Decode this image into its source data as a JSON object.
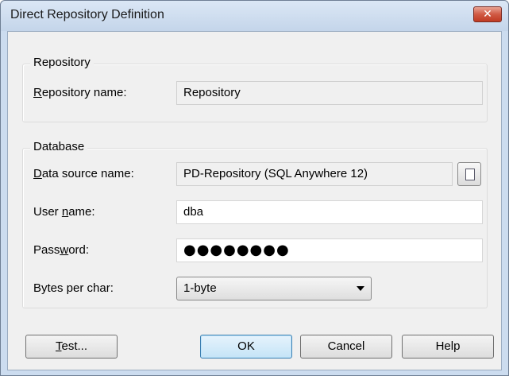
{
  "window": {
    "title": "Direct Repository Definition",
    "close_label": "✕"
  },
  "repository_group": {
    "title": "Repository",
    "name_label_underline": "R",
    "name_label_rest": "epository name:",
    "name_value": "Repository"
  },
  "database_group": {
    "title": "Database",
    "dsn_label_underline": "D",
    "dsn_label_rest": "ata source name:",
    "dsn_value": "PD-Repository (SQL Anywhere 12)",
    "user_label_pre": "User ",
    "user_label_underline": "n",
    "user_label_post": "ame:",
    "user_value": "dba",
    "password_label_pre": "Pass",
    "password_label_underline": "w",
    "password_label_post": "ord:",
    "password_value": "●●●●●●●●",
    "bytes_label": "Bytes per char:",
    "bytes_selected": "1-byte"
  },
  "buttons": {
    "test_underline": "T",
    "test_rest": "est...",
    "ok": "OK",
    "cancel": "Cancel",
    "help": "Help"
  }
}
